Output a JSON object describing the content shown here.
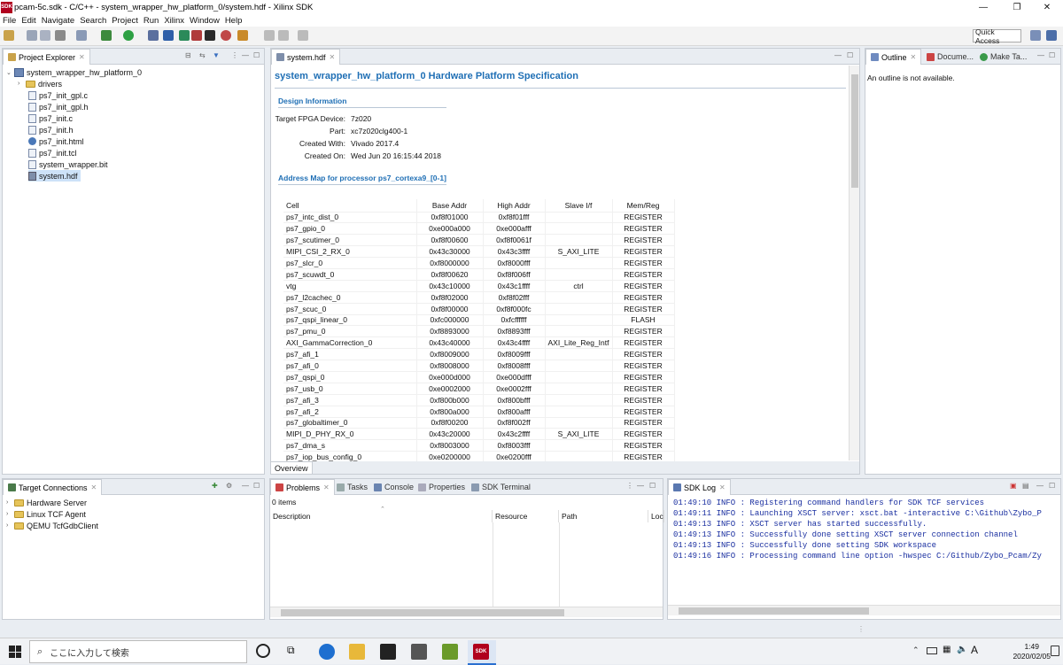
{
  "window": {
    "logo": "SDK",
    "title": "pcam-5c.sdk - C/C++ - system_wrapper_hw_platform_0/system.hdf - Xilinx SDK",
    "controls": [
      "—",
      "❐",
      "✕"
    ]
  },
  "menu": [
    "File",
    "Edit",
    "Navigate",
    "Search",
    "Project",
    "Run",
    "Xilinx",
    "Window",
    "Help"
  ],
  "toolbar": {
    "quick_access": "Quick Access"
  },
  "project_explorer": {
    "tab": "Project Explorer",
    "root": "system_wrapper_hw_platform_0",
    "items": [
      {
        "label": "drivers",
        "kind": "folder"
      },
      {
        "label": "ps7_init_gpl.c",
        "kind": "file"
      },
      {
        "label": "ps7_init_gpl.h",
        "kind": "file"
      },
      {
        "label": "ps7_init.c",
        "kind": "file"
      },
      {
        "label": "ps7_init.h",
        "kind": "file"
      },
      {
        "label": "ps7_init.html",
        "kind": "html"
      },
      {
        "label": "ps7_init.tcl",
        "kind": "file"
      },
      {
        "label": "system_wrapper.bit",
        "kind": "file"
      },
      {
        "label": "system.hdf",
        "kind": "hdf",
        "selected": true
      }
    ]
  },
  "editor": {
    "tab": "system.hdf",
    "title": "system_wrapper_hw_platform_0 Hardware Platform Specification",
    "design_info_heading": "Design Information",
    "design_info": [
      {
        "key": "Target FPGA Device:",
        "value": "7z020"
      },
      {
        "key": "Part:",
        "value": "xc7z020clg400-1"
      },
      {
        "key": "Created With:",
        "value": "Vivado 2017.4"
      },
      {
        "key": "Created On:",
        "value": "Wed Jun 20 16:15:44 2018"
      }
    ],
    "address_map_heading": "Address Map for processor ps7_cortexa9_[0-1]",
    "columns": [
      "Cell",
      "Base Addr",
      "High Addr",
      "Slave I/f",
      "Mem/Reg"
    ],
    "rows": [
      [
        "ps7_intc_dist_0",
        "0xf8f01000",
        "0xf8f01fff",
        "",
        "REGISTER"
      ],
      [
        "ps7_gpio_0",
        "0xe000a000",
        "0xe000afff",
        "",
        "REGISTER"
      ],
      [
        "ps7_scutimer_0",
        "0xf8f00600",
        "0xf8f0061f",
        "",
        "REGISTER"
      ],
      [
        "MIPI_CSI_2_RX_0",
        "0x43c30000",
        "0x43c3ffff",
        "S_AXI_LITE",
        "REGISTER"
      ],
      [
        "ps7_slcr_0",
        "0xf8000000",
        "0xf8000fff",
        "",
        "REGISTER"
      ],
      [
        "ps7_scuwdt_0",
        "0xf8f00620",
        "0xf8f006ff",
        "",
        "REGISTER"
      ],
      [
        "vtg",
        "0x43c10000",
        "0x43c1ffff",
        "ctrl",
        "REGISTER"
      ],
      [
        "ps7_l2cachec_0",
        "0xf8f02000",
        "0xf8f02fff",
        "",
        "REGISTER"
      ],
      [
        "ps7_scuc_0",
        "0xf8f00000",
        "0xf8f000fc",
        "",
        "REGISTER"
      ],
      [
        "ps7_qspi_linear_0",
        "0xfc000000",
        "0xfcffffff",
        "",
        "FLASH"
      ],
      [
        "ps7_pmu_0",
        "0xf8893000",
        "0xf8893fff",
        "",
        "REGISTER"
      ],
      [
        "AXI_GammaCorrection_0",
        "0x43c40000",
        "0x43c4ffff",
        "AXI_Lite_Reg_Intf",
        "REGISTER"
      ],
      [
        "ps7_afi_1",
        "0xf8009000",
        "0xf8009fff",
        "",
        "REGISTER"
      ],
      [
        "ps7_afi_0",
        "0xf8008000",
        "0xf8008fff",
        "",
        "REGISTER"
      ],
      [
        "ps7_qspi_0",
        "0xe000d000",
        "0xe000dfff",
        "",
        "REGISTER"
      ],
      [
        "ps7_usb_0",
        "0xe0002000",
        "0xe0002fff",
        "",
        "REGISTER"
      ],
      [
        "ps7_afi_3",
        "0xf800b000",
        "0xf800bfff",
        "",
        "REGISTER"
      ],
      [
        "ps7_afi_2",
        "0xf800a000",
        "0xf800afff",
        "",
        "REGISTER"
      ],
      [
        "ps7_globaltimer_0",
        "0xf8f00200",
        "0xf8f002ff",
        "",
        "REGISTER"
      ],
      [
        "MIPI_D_PHY_RX_0",
        "0x43c20000",
        "0x43c2ffff",
        "S_AXI_LITE",
        "REGISTER"
      ],
      [
        "ps7_dma_s",
        "0xf8003000",
        "0xf8003fff",
        "",
        "REGISTER"
      ],
      [
        "ps7_iop_bus_config_0",
        "0xe0200000",
        "0xe0200fff",
        "",
        "REGISTER"
      ]
    ],
    "bottom_tab": "Overview"
  },
  "outline": {
    "tabs": [
      "Outline",
      "Docume...",
      "Make Ta..."
    ],
    "message": "An outline is not available."
  },
  "target_connections": {
    "tab": "Target Connections",
    "items": [
      "Hardware Server",
      "Linux TCF Agent",
      "QEMU TcfGdbClient"
    ]
  },
  "problems": {
    "tabs": [
      "Problems",
      "Tasks",
      "Console",
      "Properties",
      "SDK Terminal"
    ],
    "count": "0 items",
    "columns": [
      "Description",
      "Resource",
      "Path",
      "Loca"
    ]
  },
  "sdk_log": {
    "tab": "SDK Log",
    "lines": [
      "01:49:10 INFO   : Registering command handlers for SDK TCF services",
      "01:49:11 INFO   : Launching XSCT server: xsct.bat -interactive C:\\Github\\Zybo_P",
      "01:49:13 INFO   : XSCT server has started successfully.",
      "01:49:13 INFO   : Successfully done setting XSCT server connection channel",
      "01:49:13 INFO   : Successfully done setting SDK workspace",
      "01:49:16 INFO   : Processing command line option -hwspec C:/Github/Zybo_Pcam/Zy"
    ]
  },
  "taskbar": {
    "search_placeholder": "ここに入力して検索",
    "ime": "A",
    "time": "1:49",
    "date": "2020/02/05",
    "app_label": "SDK"
  }
}
